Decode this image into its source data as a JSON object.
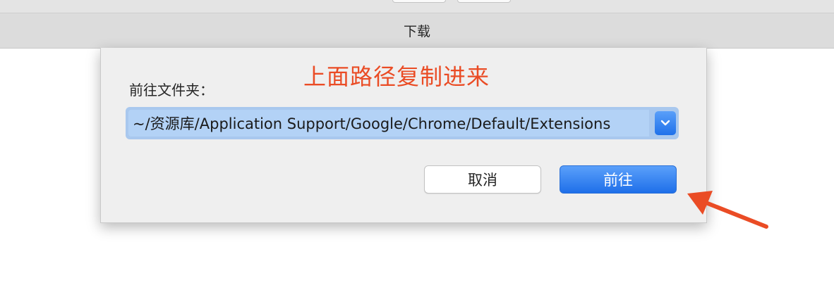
{
  "window": {
    "title": "下载"
  },
  "dialog": {
    "annotation": "上面路径复制进来",
    "label": "前往文件夹：",
    "path_value": "~/资源库/Application Support/Google/Chrome/Default/Extensions",
    "cancel_label": "取消",
    "go_label": "前往"
  },
  "colors": {
    "annotation": "#ea4c25",
    "accent": "#1e6fe9",
    "selection": "#b3d2f6"
  }
}
